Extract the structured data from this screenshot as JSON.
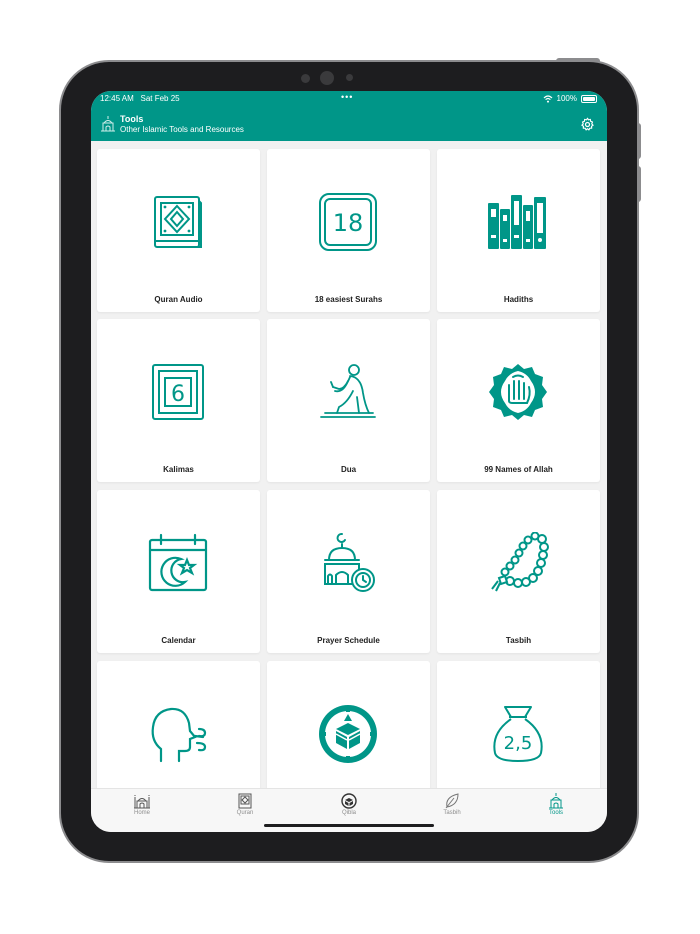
{
  "status": {
    "time": "12:45 AM",
    "date": "Sat Feb 25",
    "battery": "100%"
  },
  "header": {
    "title": "Tools",
    "subtitle": "Other Islamic Tools and Resources"
  },
  "colors": {
    "accent": "#009688"
  },
  "tools": [
    {
      "label": "Quran Audio",
      "icon": "quran-book-icon"
    },
    {
      "label": "18 easiest Surahs",
      "icon": "surah-18-icon",
      "number": "18"
    },
    {
      "label": "Hadiths",
      "icon": "hadith-books-icon"
    },
    {
      "label": "Kalimas",
      "icon": "kalima-6-icon",
      "number": "6"
    },
    {
      "label": "Dua",
      "icon": "dua-person-icon"
    },
    {
      "label": "99 Names of Allah",
      "icon": "allah-names-icon"
    },
    {
      "label": "Calendar",
      "icon": "calendar-moon-icon"
    },
    {
      "label": "Prayer Schedule",
      "icon": "mosque-clock-icon"
    },
    {
      "label": "Tasbih",
      "icon": "tasbih-beads-icon"
    },
    {
      "label": "",
      "icon": "breath-head-icon"
    },
    {
      "label": "",
      "icon": "kaaba-compass-icon"
    },
    {
      "label": "",
      "icon": "zakat-bag-icon",
      "number": "2,5"
    }
  ],
  "tabs": [
    {
      "label": "Home",
      "icon": "mosque-icon"
    },
    {
      "label": "Quran",
      "icon": "quran-icon"
    },
    {
      "label": "Qibla",
      "icon": "qibla-icon"
    },
    {
      "label": "Tasbih",
      "icon": "leaf-icon"
    },
    {
      "label": "Tools",
      "icon": "tools-icon"
    }
  ]
}
